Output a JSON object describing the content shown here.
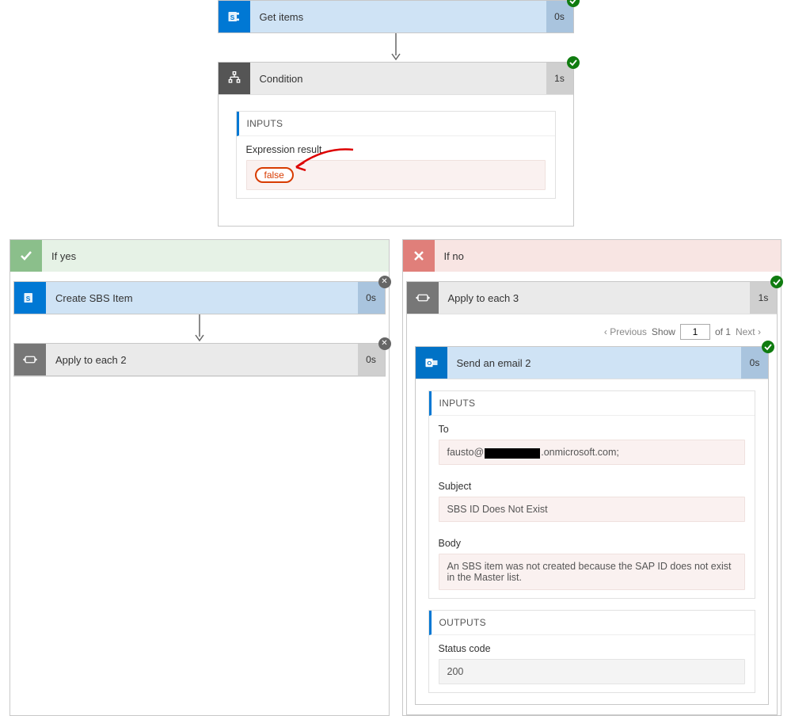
{
  "getItems": {
    "title": "Get items",
    "time": "0s"
  },
  "condition": {
    "title": "Condition",
    "time": "1s",
    "inputs": {
      "heading": "INPUTS",
      "expr_label": "Expression result",
      "expr_value": "false"
    }
  },
  "branches": {
    "yes": {
      "title": "If yes",
      "create": {
        "title": "Create SBS Item",
        "time": "0s"
      },
      "loop": {
        "title": "Apply to each 2",
        "time": "0s"
      }
    },
    "no": {
      "title": "If no",
      "loop": {
        "title": "Apply to each 3",
        "time": "1s",
        "pager": {
          "prev": "Previous",
          "show": "Show",
          "page": "1",
          "of": "of 1",
          "next": "Next"
        },
        "email": {
          "title": "Send an email 2",
          "time": "0s",
          "inputs": {
            "heading": "INPUTS",
            "to_label": "To",
            "to_prefix": "fausto@",
            "to_suffix": ".onmicrosoft.com;",
            "subject_label": "Subject",
            "subject_value": "SBS ID Does Not Exist",
            "body_label": "Body",
            "body_value": "An SBS item was not created because the SAP ID does not exist in the Master list."
          },
          "outputs": {
            "heading": "OUTPUTS",
            "status_label": "Status code",
            "status_value": "200"
          }
        }
      }
    }
  }
}
